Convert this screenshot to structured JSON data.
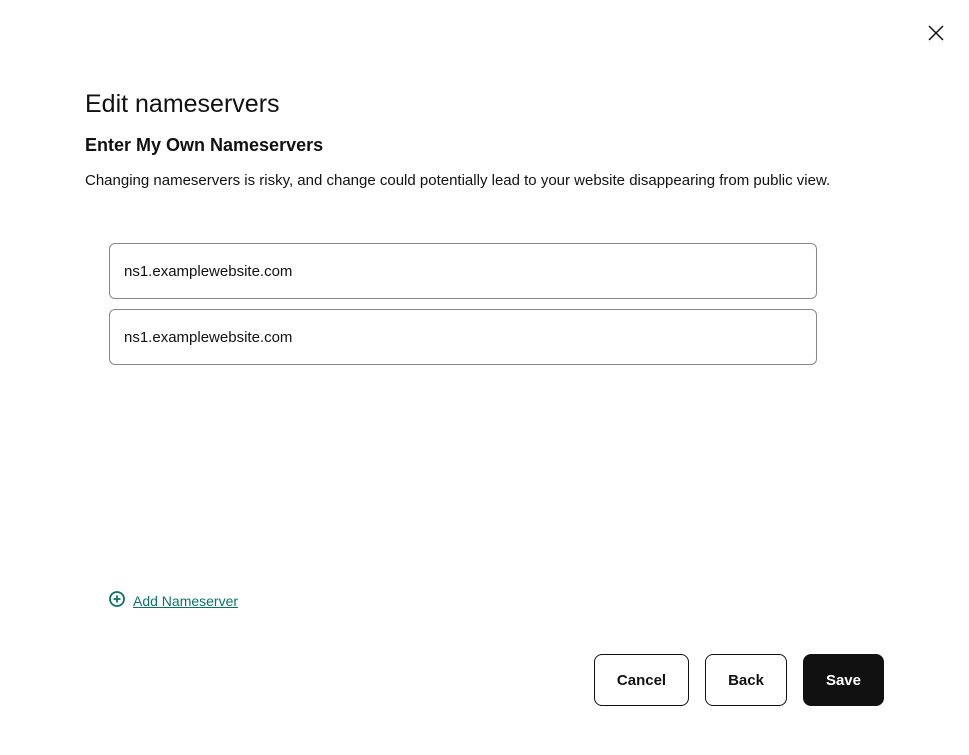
{
  "modal": {
    "title": "Edit nameservers",
    "subtitle": "Enter My Own Nameservers",
    "warning": "Changing nameservers is risky, and change could potentially lead to your website disappearing from public view."
  },
  "nameservers": [
    {
      "value": "ns1.examplewebsite.com"
    },
    {
      "value": "ns1.examplewebsite.com"
    }
  ],
  "actions": {
    "add_label": "Add Nameserver",
    "cancel_label": "Cancel",
    "back_label": "Back",
    "save_label": "Save"
  }
}
